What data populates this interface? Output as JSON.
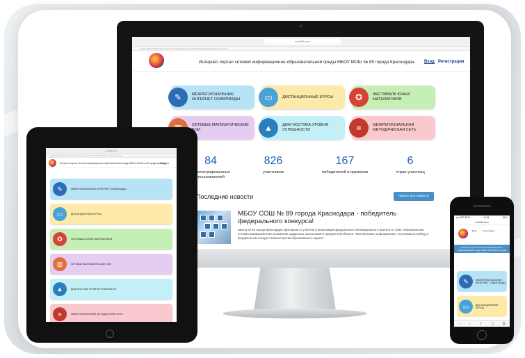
{
  "colors": {
    "accent": "#1e5fb8",
    "tile_blue": "#b7e3f7",
    "tile_yellow": "#fde9a8",
    "tile_green": "#c6efb6",
    "tile_purple": "#e5cdf2",
    "tile_cyan": "#c3f0f7",
    "tile_pink": "#f9c9cf",
    "button": "#4a90c7"
  },
  "desktop": {
    "url": "sosh89.com",
    "bookmarks": "Apple  Яндекс  Википедия  Новости  Популярные  YouTube  Wikipedia  Карты  Новостная лента",
    "site_title": "Интернет-портал сетевой информационно-образовательной среды МБОУ МОШ № 89 города Краснодара",
    "login": "Вход",
    "register": "Регистрация",
    "tiles": [
      {
        "label": "Межрегиональные интернет олимпиады",
        "icon": "tools-icon"
      },
      {
        "label": "Дистанционные курсы",
        "icon": "laptop-icon"
      },
      {
        "label": "Фестиваль юных математиков",
        "icon": "medal-icon"
      },
      {
        "label": "Сетевые математические бои",
        "icon": "chart-icon"
      },
      {
        "label": "Диагностика уровня успешности",
        "icon": "graduation-cap-icon"
      },
      {
        "label": "Межрегиональная методическая сеть",
        "icon": "books-icon"
      }
    ],
    "stats": [
      {
        "num": "84",
        "caption": "зарегистрированных пользователей"
      },
      {
        "num": "826",
        "caption": "участников"
      },
      {
        "num": "167",
        "caption": "победителей и призеров"
      },
      {
        "num": "6",
        "caption": "стран-участниц"
      }
    ],
    "news_heading": "Последние новости",
    "all_news_button": "Читать все новости",
    "news_title": "МБОУ СОШ № 89 города Краснодара - победитель федерального конкурса!",
    "news_text": "Школа № 89 города Краснодара приглашает к участию в реализации федерального инновационного проекта по теме «Межшкольная сетевая взаимодействие в развитии одаренных школьников в предметной области «Математика и информатика» получившего победу в федеральном конкурсе Министерства образования и науки Р..."
  },
  "tablet": {
    "url": "sosh89.com",
    "site_title": "Интернет-портал сетевой информационно-образовательной среды МБОУ МОШ № 89 города Краснодара",
    "login": "Вход",
    "tiles": [
      {
        "label": "Межрегиональные интернет олимпиады",
        "icon": "tools-icon"
      },
      {
        "label": "Дистанционные курсы",
        "icon": "laptop-icon"
      },
      {
        "label": "Фестиваль юных математиков",
        "icon": "medal-icon"
      },
      {
        "label": "Сетевые математические бои",
        "icon": "chart-icon"
      },
      {
        "label": "Диагностика уровня успешности",
        "icon": "graduation-cap-icon"
      },
      {
        "label": "Межрегиональная методическая сеть",
        "icon": "books-icon"
      }
    ]
  },
  "phone": {
    "carrier": "•••• MTS RUS",
    "time": "14:23",
    "battery": "62 %",
    "url": "sosh89.com",
    "site_title": "Интернет-портал сетевой информационно-образовательной среды МБОУ МОШ № 89 города Краснодара",
    "login": "Вход",
    "register": "Регистрация",
    "nav": "Интернет-портал сетевой информационно-образовательной среды МБОУ МОШ № 89 города Краснодара",
    "tiles": [
      {
        "label": "Межрегиональные интернет олимпиады",
        "icon": "tools-icon"
      },
      {
        "label": "Дистанционные курсы",
        "icon": "laptop-icon"
      }
    ]
  }
}
